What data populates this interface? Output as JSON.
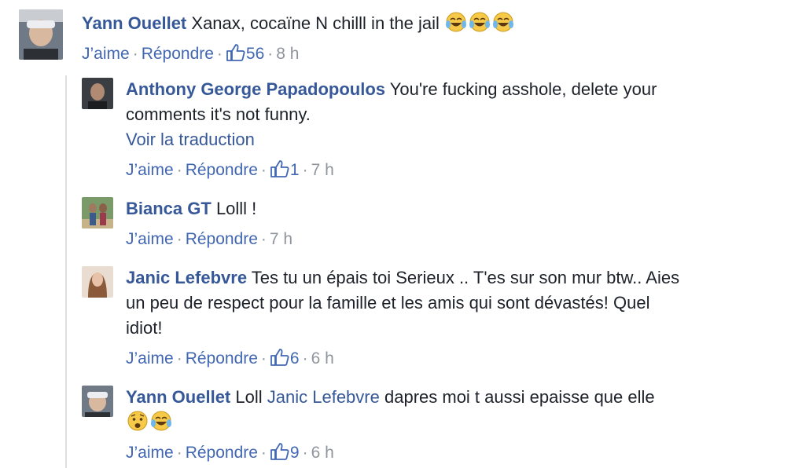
{
  "comments": [
    {
      "author": "Yann Ouellet",
      "text": "Xanax, cocaïne N chilll in the jail",
      "emoji": [
        "😂",
        "😂",
        "😂"
      ],
      "like": "J’aime",
      "reply": "Répondre",
      "likes": "56",
      "time": "8 h"
    },
    {
      "author": "Anthony George Papadopoulos",
      "text_line1": "You're fucking asshole, delete your",
      "text_line2": "comments it's not funny.",
      "translate": "Voir la traduction",
      "like": "J’aime",
      "reply": "Répondre",
      "likes": "1",
      "time": "7 h"
    },
    {
      "author": "Bianca GT",
      "text": "Lolll !",
      "like": "J’aime",
      "reply": "Répondre",
      "time": "7 h"
    },
    {
      "author": "Janic Lefebvre",
      "text_line1": "Tes tu un épais toi Serieux .. T'es sur son mur btw.. Aies",
      "text_line2": "un peu de respect pour la famille et les amis qui sont dévastés! Quel",
      "text_line3": "idiot!",
      "like": "J’aime",
      "reply": "Répondre",
      "likes": "6",
      "time": "6 h"
    },
    {
      "author": "Yann Ouellet",
      "text_pre": "Loll",
      "mention": "Janic Lefebvre",
      "text_post": "dapres moi t aussi epaisse que elle",
      "emoji": [
        "😧",
        "😂"
      ],
      "like": "J’aime",
      "reply": "Répondre",
      "likes": "9",
      "time": "6 h"
    }
  ],
  "colors": {
    "link": "#365899",
    "meta": "#90949c",
    "text": "#1d2129",
    "thread_line": "#dddfe2"
  },
  "icons": {
    "like": "thumbs-up-icon"
  }
}
